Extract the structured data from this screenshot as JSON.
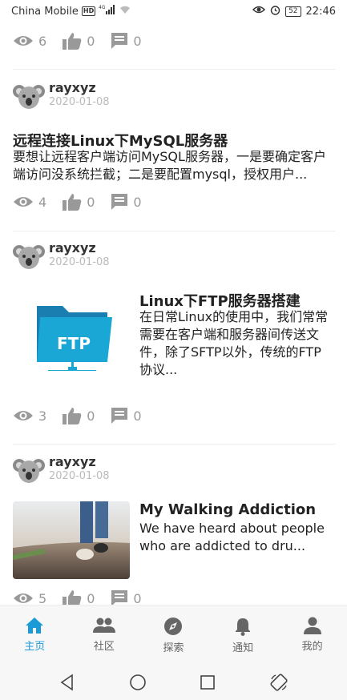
{
  "status_bar": {
    "carrier": "China Mobile",
    "hd": "HD",
    "network": "4G",
    "battery": "52",
    "time": "22:46"
  },
  "posts": [
    {
      "views": "6",
      "likes": "0",
      "comments": "0"
    },
    {
      "author": "rayxyz",
      "date": "2020-01-08",
      "title": "远程连接Linux下MySQL服务器",
      "summary": "要想让远程客户端访问MySQL服务器，一是要确定客户端访问没系统拦截；二是要配置mysql，授权用户...",
      "views": "4",
      "likes": "0",
      "comments": "0"
    },
    {
      "author": "rayxyz",
      "date": "2020-01-08",
      "title": "Linux下FTP服务器搭建",
      "summary": "在日常Linux的使用中，我们常常需要在客户端和服务器间传送文件，除了SFTP以外，传统的FTP协议...",
      "thumb_text": "FTP",
      "views": "3",
      "likes": "0",
      "comments": "0"
    },
    {
      "author": "rayxyz",
      "date": "2020-01-08",
      "title": "My Walking Addiction",
      "summary": "We have heard about people who are addicted to dru...",
      "views": "5",
      "likes": "0",
      "comments": "0"
    }
  ],
  "bottom_nav": [
    {
      "label": "主页",
      "icon": "home-icon",
      "active": true
    },
    {
      "label": "社区",
      "icon": "people-icon",
      "active": false
    },
    {
      "label": "探索",
      "icon": "compass-icon",
      "active": false
    },
    {
      "label": "通知",
      "icon": "bell-icon",
      "active": false
    },
    {
      "label": "我的",
      "icon": "person-icon",
      "active": false
    }
  ],
  "colors": {
    "accent": "#1a9bd8",
    "stat_gray": "#999999",
    "date_gray": "#bbbbbb"
  }
}
